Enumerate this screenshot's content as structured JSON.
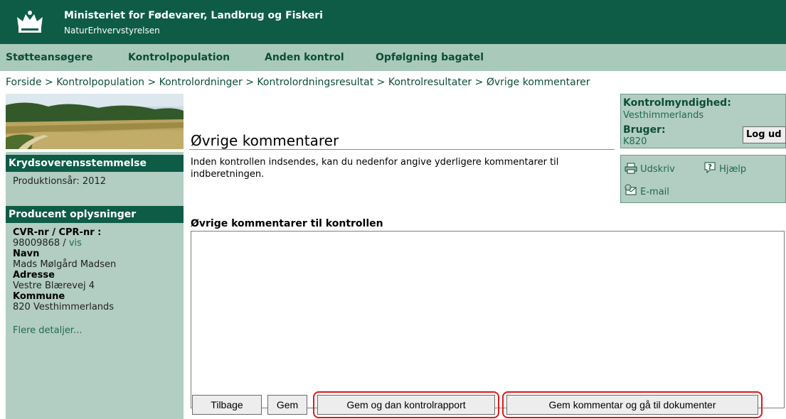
{
  "header": {
    "org_name": "Ministeriet for Fødevarer, Landbrug og Fiskeri",
    "org_sub": "NaturErhvervstyrelsen",
    "logo_icon": "crown-icon"
  },
  "topnav": [
    "Støtteansøgere",
    "Kontrolpopulation",
    "Anden kontrol",
    "Opfølgning bagatel"
  ],
  "breadcrumb": "Forside > Kontrolpopulation > Kontrolordninger > Kontrolordningsresultat > Kontrolresultater > Øvrige kommentarer",
  "sidebar": {
    "section1_title": "Krydsoverensstemmelse",
    "production_year": "Produktionsår: 2012",
    "section2_title": "Producent oplysninger",
    "cvr_label": "CVR-nr / CPR-nr :",
    "cvr_value": "98009868 / ",
    "cvr_link": "vis",
    "name_label": "Navn",
    "name_value": "Mads Mølgård Madsen",
    "address_label": "Adresse",
    "address_value": "Vestre Blærevej 4",
    "municipality_label": "Kommune",
    "municipality_value": "820 Vesthimmerlands",
    "more_link": "Flere detaljer..."
  },
  "main": {
    "title": "Øvrige kommentarer",
    "intro": "Inden kontrollen indsendes, kan du nedenfor angive yderligere kommentarer til indberetningen.",
    "comments_label": "Øvrige kommentarer til kontrollen",
    "comments_value": ""
  },
  "authority": {
    "label": "Kontrolmyndighed:",
    "value": "Vesthimmerlands",
    "user_label": "Bruger:",
    "user_value": "K820",
    "logout": "Log ud"
  },
  "tools": {
    "print": "Udskriv",
    "help": "Hjælp",
    "email": "E-mail"
  },
  "buttons": {
    "back": "Tilbage",
    "save": "Gem",
    "save_report": "Gem og dan kontrolrapport",
    "save_documents": "Gem kommentar og gå til dokumenter"
  },
  "colors": {
    "header": "#0e5c46",
    "nav": "#a9c9bb",
    "sidebar": "#b2cdc2",
    "highlight": "#dd1a1a"
  }
}
